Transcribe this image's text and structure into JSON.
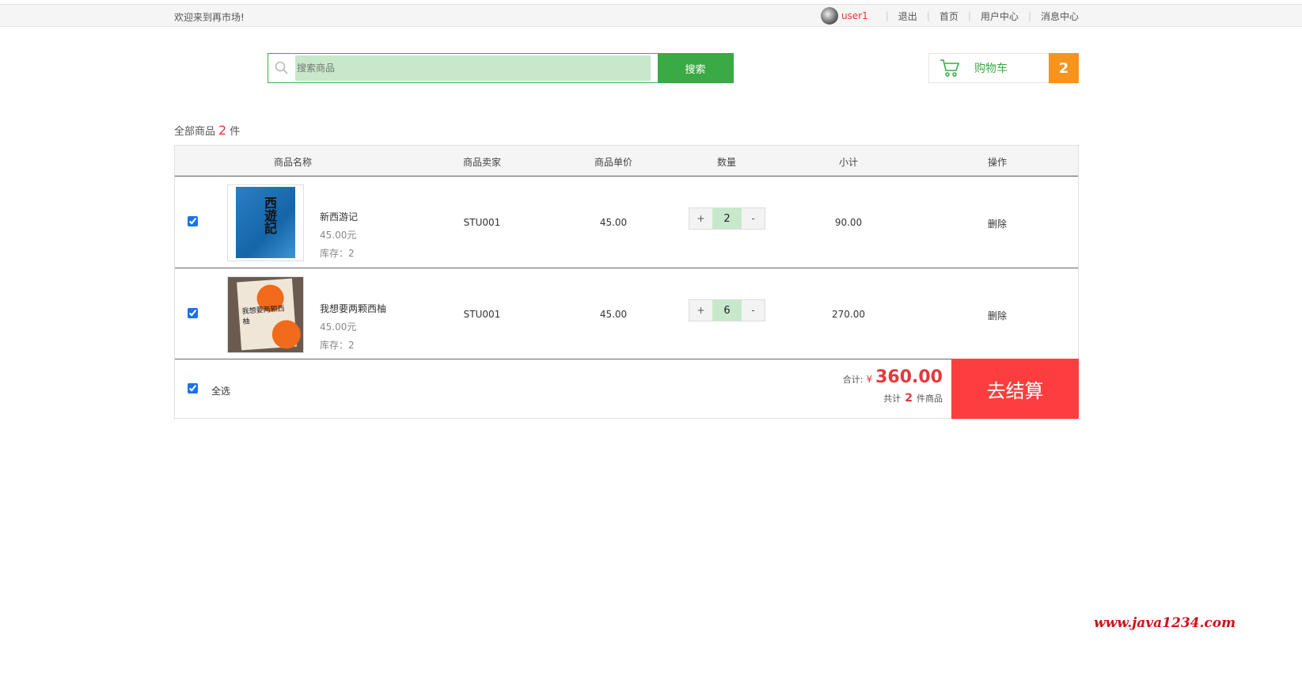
{
  "topbar": {
    "welcome": "欢迎来到再市场!",
    "user": "user1",
    "links": [
      "退出",
      "首页",
      "用户中心",
      "消息中心"
    ]
  },
  "search": {
    "placeholder": "搜索商品",
    "button": "搜索"
  },
  "cart": {
    "label": "购物车",
    "count": "2"
  },
  "summary": {
    "prefix": "全部商品",
    "count": "2",
    "suffix": "件"
  },
  "table": {
    "headers": [
      "商品名称",
      "商品卖家",
      "商品单价",
      "数量",
      "小计",
      "操作"
    ],
    "rows": [
      {
        "name": "新西游记",
        "price_label": "45.00元",
        "stock": "库存：2",
        "seller": "STU001",
        "price": "45.00",
        "qty": "2",
        "subtotal": "90.00",
        "action": "删除",
        "cover_text": "西遊記",
        "checked": true
      },
      {
        "name": "我想要两颗西柚",
        "price_label": "45.00元",
        "stock": "库存：2",
        "seller": "STU001",
        "price": "45.00",
        "qty": "6",
        "subtotal": "270.00",
        "action": "删除",
        "cover_text": "我想要两颗西柚",
        "checked": true
      }
    ],
    "qty_plus": "+",
    "qty_minus": "-"
  },
  "footer": {
    "select_all": "全选",
    "total_label": "合计:",
    "currency": "¥",
    "total": "360.00",
    "count_prefix": "共计",
    "count": "2",
    "count_suffix": "件商品",
    "checkout": "去结算"
  },
  "watermark": "www.java1234.com"
}
